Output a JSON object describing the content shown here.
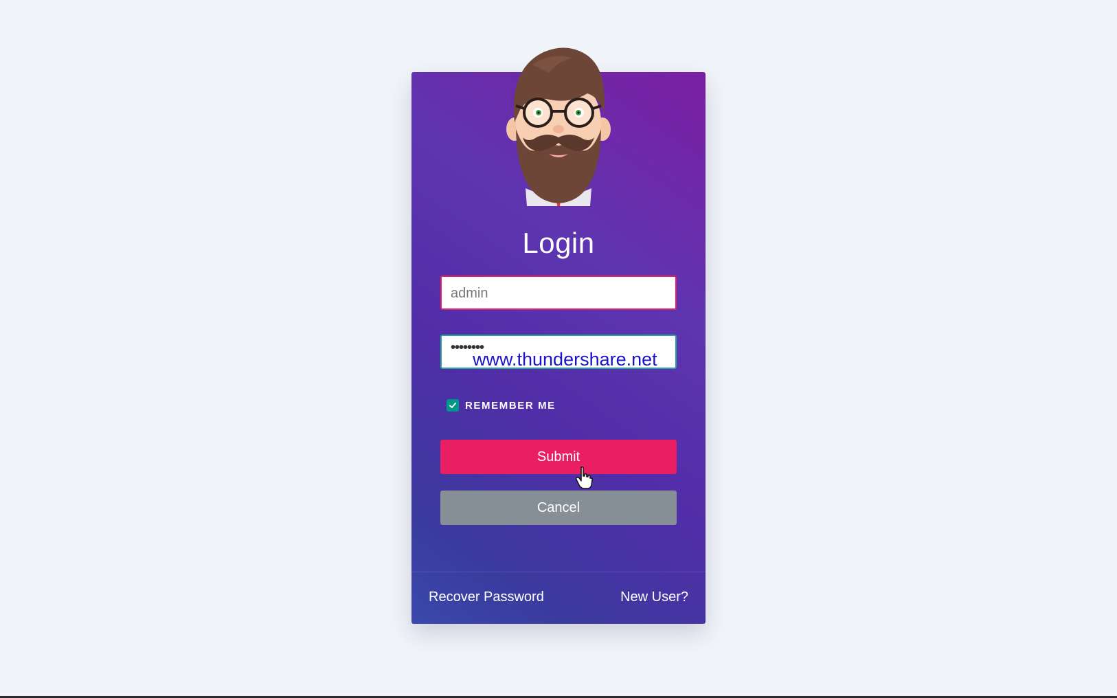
{
  "login": {
    "title": "Login",
    "username": {
      "value": "admin"
    },
    "password": {
      "masked_value": "••••••••"
    },
    "remember_me": {
      "label": "REMEMBER ME",
      "checked": true
    },
    "submit_label": "Submit",
    "cancel_label": "Cancel"
  },
  "watermark": "www.thundershare.net",
  "footer": {
    "recover_password": "Recover Password",
    "new_user": "New User?"
  },
  "colors": {
    "background": "#f1f5f9",
    "card_gradient_start": "#7b1fa2",
    "card_gradient_end": "#3949ab",
    "submit": "#e91e63",
    "cancel": "#868e96",
    "checkbox": "#009688"
  },
  "icons": {
    "avatar": "bearded-man-avatar",
    "checkbox": "check-icon",
    "cursor": "hand-pointer-cursor"
  }
}
